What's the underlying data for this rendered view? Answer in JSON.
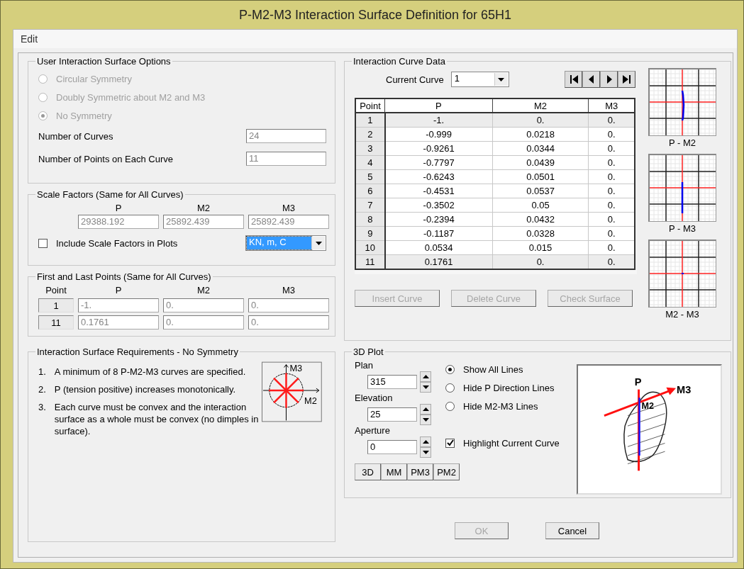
{
  "window": {
    "title": "P-M2-M3 Interaction Surface Definition for 65H1"
  },
  "menu": [
    "Edit"
  ],
  "surface_options": {
    "title": "User Interaction Surface Options",
    "symmetry": [
      {
        "label": "Circular Symmetry",
        "selected": false,
        "disabled": true
      },
      {
        "label": "Doubly Symmetric about M2 and M3",
        "selected": false,
        "disabled": true
      },
      {
        "label": "No Symmetry",
        "selected": true,
        "disabled": true
      }
    ],
    "fields": [
      {
        "label": "Number of Curves",
        "value": "24",
        "disabled": true
      },
      {
        "label": "Number of Points on Each Curve",
        "value": "11",
        "disabled": true
      }
    ]
  },
  "scale_factors": {
    "title": "Scale Factors (Same for All Curves)",
    "columns": [
      "P",
      "M2",
      "M3"
    ],
    "values": [
      {
        "value": "29388.192",
        "disabled": true
      },
      {
        "value": "25892.439",
        "disabled": true
      },
      {
        "value": "25892.439",
        "disabled": true
      }
    ],
    "include_in_plots": {
      "label": "Include Scale Factors in Plots",
      "checked": false
    },
    "units": {
      "value": "KN, m, C",
      "focused": true
    }
  },
  "first_last": {
    "title": "First and Last Points (Same for All Curves)",
    "columns": [
      "Point",
      "P",
      "M2",
      "M3"
    ],
    "rows": [
      {
        "point": "1",
        "values": [
          {
            "value": "-1.",
            "disabled": true
          },
          {
            "value": "0.",
            "disabled": true
          },
          {
            "value": "0.",
            "disabled": true
          }
        ]
      },
      {
        "point": "11",
        "values": [
          {
            "value": "0.1761",
            "disabled": true
          },
          {
            "value": "0.",
            "disabled": true
          },
          {
            "value": "0.",
            "disabled": true
          }
        ]
      }
    ]
  },
  "requirements": {
    "title": "Interaction Surface Requirements - No Symmetry",
    "items": [
      {
        "number": "1.",
        "text": "A minimum of 8 P-M2-M3 curves are specified."
      },
      {
        "number": "2.",
        "text": "P (tension positive) increases monotonically."
      },
      {
        "number": "3.",
        "text": "Each curve must be convex and the interaction surface as a whole must be convex (no dimples in surface)."
      }
    ],
    "diagram_labels": [
      "M3",
      "M2"
    ]
  },
  "curve_data": {
    "title": "Interaction Curve Data",
    "current_curve": {
      "label": "Current Curve",
      "value": "1"
    },
    "nav_buttons": [
      {
        "kind": "first"
      },
      {
        "kind": "prev"
      },
      {
        "kind": "next"
      },
      {
        "kind": "last"
      }
    ],
    "table": {
      "columns": [
        "Point",
        "P",
        "M2",
        "M3"
      ],
      "rows": [
        {
          "cells": [
            "1",
            "-1.",
            "0.",
            "0."
          ],
          "highlighted": true
        },
        {
          "cells": [
            "2",
            "-0.999",
            "0.0218",
            "0."
          ],
          "highlighted": false
        },
        {
          "cells": [
            "3",
            "-0.9261",
            "0.0344",
            "0."
          ],
          "highlighted": false
        },
        {
          "cells": [
            "4",
            "-0.7797",
            "0.0439",
            "0."
          ],
          "highlighted": false
        },
        {
          "cells": [
            "5",
            "-0.6243",
            "0.0501",
            "0."
          ],
          "highlighted": false
        },
        {
          "cells": [
            "6",
            "-0.4531",
            "0.0537",
            "0."
          ],
          "highlighted": false
        },
        {
          "cells": [
            "7",
            "-0.3502",
            "0.05",
            "0."
          ],
          "highlighted": false
        },
        {
          "cells": [
            "8",
            "-0.2394",
            "0.0432",
            "0."
          ],
          "highlighted": false
        },
        {
          "cells": [
            "9",
            "-0.1187",
            "0.0328",
            "0."
          ],
          "highlighted": false
        },
        {
          "cells": [
            "10",
            "0.0534",
            "0.015",
            "0."
          ],
          "highlighted": false
        },
        {
          "cells": [
            "11",
            "0.1761",
            "0.",
            "0."
          ],
          "highlighted": true
        }
      ]
    },
    "buttons": [
      {
        "label": "Insert Curve",
        "disabled": true
      },
      {
        "label": "Delete Curve",
        "disabled": true
      },
      {
        "label": "Check Surface",
        "disabled": true
      }
    ],
    "mini_plots": [
      {
        "kind": "p-m2",
        "label": "P - M2"
      },
      {
        "kind": "p-m3",
        "label": "P - M3"
      },
      {
        "kind": "m2-m3",
        "label": "M2 - M3"
      }
    ]
  },
  "plot_3d": {
    "title": "3D Plot",
    "spinners": [
      {
        "label": "Plan",
        "value": "315"
      },
      {
        "label": "Elevation",
        "value": "25"
      },
      {
        "label": "Aperture",
        "value": "0"
      }
    ],
    "line_options": [
      {
        "label": "Show All Lines",
        "selected": true
      },
      {
        "label": "Hide P Direction Lines",
        "selected": false
      },
      {
        "label": "Hide M2-M3 Lines",
        "selected": false
      }
    ],
    "highlight_current": {
      "label": "Highlight Current Curve",
      "checked": true
    },
    "view_buttons": [
      "3D",
      "MM",
      "PM3",
      "PM2"
    ],
    "axis_labels": [
      "P",
      "M3",
      "M2"
    ]
  },
  "buttons": [
    {
      "label": "OK",
      "disabled": true
    },
    {
      "label": "Cancel",
      "disabled": false
    }
  ]
}
